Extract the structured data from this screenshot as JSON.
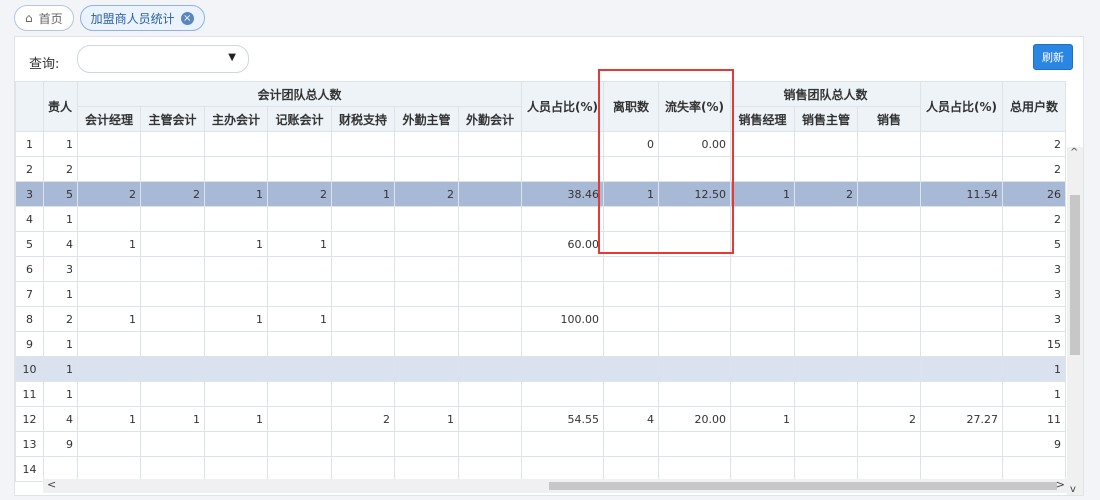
{
  "tabs": {
    "home": "首页",
    "active": "加盟商人员统计"
  },
  "toolbar": {
    "query_label": "查询:",
    "refresh_label": "刷新"
  },
  "table": {
    "headers": {
      "owner": "责人",
      "accounting_group": "会计团队总人数",
      "accounting_cols": [
        "会计经理",
        "主管会计",
        "主办会计",
        "记账会计",
        "财税支持",
        "外勤主管",
        "外勤会计"
      ],
      "ratio1": "人员占比(%)",
      "resigned": "离职数",
      "loss_rate": "流失率(%)",
      "sales_group": "销售团队总人数",
      "sales_cols": [
        "销售经理",
        "销售主管",
        "销售"
      ],
      "ratio2": "人员占比(%)",
      "total_users": "总用户数"
    },
    "rows": [
      {
        "n": "1",
        "cells": [
          "1",
          "",
          "",
          "",
          "",
          "",
          "",
          "",
          "",
          "0",
          "0.00",
          "",
          "",
          "",
          "",
          "2"
        ]
      },
      {
        "n": "2",
        "cells": [
          "2",
          "",
          "",
          "",
          "",
          "",
          "",
          "",
          "",
          "",
          "",
          "",
          "",
          "",
          "",
          "2"
        ]
      },
      {
        "n": "3",
        "cells": [
          "5",
          "2",
          "2",
          "1",
          "2",
          "1",
          "2",
          "",
          "38.46",
          "1",
          "12.50",
          "1",
          "2",
          "",
          "11.54",
          "26"
        ]
      },
      {
        "n": "4",
        "cells": [
          "1",
          "",
          "",
          "",
          "",
          "",
          "",
          "",
          "",
          "",
          "",
          "",
          "",
          "",
          "",
          "2"
        ]
      },
      {
        "n": "5",
        "cells": [
          "4",
          "1",
          "",
          "1",
          "1",
          "",
          "",
          "",
          "60.00",
          "",
          "",
          "",
          "",
          "",
          "",
          "5"
        ]
      },
      {
        "n": "6",
        "cells": [
          "3",
          "",
          "",
          "",
          "",
          "",
          "",
          "",
          "",
          "",
          "",
          "",
          "",
          "",
          "",
          "3"
        ]
      },
      {
        "n": "7",
        "cells": [
          "1",
          "",
          "",
          "",
          "",
          "",
          "",
          "",
          "",
          "",
          "",
          "",
          "",
          "",
          "",
          "3"
        ]
      },
      {
        "n": "8",
        "cells": [
          "2",
          "1",
          "",
          "1",
          "1",
          "",
          "",
          "",
          "100.00",
          "",
          "",
          "",
          "",
          "",
          "",
          "3"
        ]
      },
      {
        "n": "9",
        "cells": [
          "1",
          "",
          "",
          "",
          "",
          "",
          "",
          "",
          "",
          "",
          "",
          "",
          "",
          "",
          "",
          "15"
        ]
      },
      {
        "n": "10",
        "cells": [
          "1",
          "",
          "",
          "",
          "",
          "",
          "",
          "",
          "",
          "",
          "",
          "",
          "",
          "",
          "",
          "1"
        ]
      },
      {
        "n": "11",
        "cells": [
          "1",
          "",
          "",
          "",
          "",
          "",
          "",
          "",
          "",
          "",
          "",
          "",
          "",
          "",
          "",
          "1"
        ]
      },
      {
        "n": "12",
        "cells": [
          "4",
          "1",
          "1",
          "1",
          "",
          "2",
          "1",
          "",
          "54.55",
          "4",
          "20.00",
          "1",
          "",
          "2",
          "27.27",
          "11"
        ]
      },
      {
        "n": "13",
        "cells": [
          "9",
          "",
          "",
          "",
          "",
          "",
          "",
          "",
          "",
          "",
          "",
          "",
          "",
          "",
          "",
          "9"
        ]
      },
      {
        "n": "14",
        "cells": [
          "",
          "",
          "",
          "",
          "",
          "",
          "",
          "",
          "",
          "",
          "",
          "",
          "",
          "",
          "",
          ""
        ]
      }
    ]
  }
}
